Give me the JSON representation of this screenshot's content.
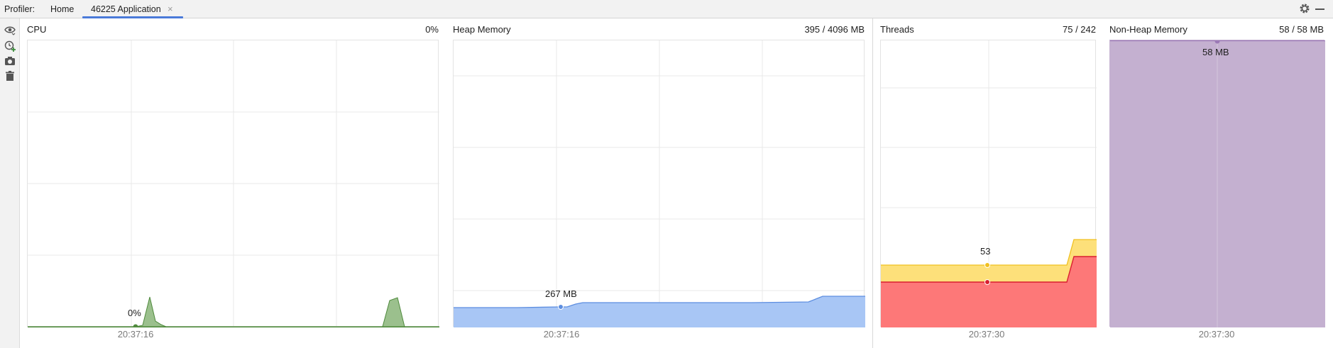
{
  "topbar": {
    "profiler_label": "Profiler:",
    "tab_home": "Home",
    "tab_app": "46225 Application",
    "tab_close": "×"
  },
  "panels": {
    "cpu": {
      "title": "CPU",
      "value": "0%",
      "hover_label": "0%",
      "time": "20:37:16"
    },
    "heap": {
      "title": "Heap Memory",
      "value": "395 / 4096 MB",
      "hover_label": "267 MB",
      "time": "20:37:16"
    },
    "threads": {
      "title": "Threads",
      "value": "75 / 242",
      "hover_label": "53",
      "time": "20:37:30"
    },
    "nonheap": {
      "title": "Non-Heap Memory",
      "value": "58 / 58 MB",
      "hover_label": "58 MB",
      "time": "20:37:30"
    }
  },
  "colors": {
    "cpu_fill": "#9bc08d",
    "cpu_line": "#4f8a3d",
    "heap_fill": "#a8c6f5",
    "heap_line": "#5d8ee0",
    "threads_total_fill": "#fde07a",
    "threads_total_line": "#f0c020",
    "threads_live_fill": "#fd7878",
    "threads_live_line": "#d91f2f",
    "nonheap_fill": "#c4b0d0",
    "nonheap_line": "#9c7ab6",
    "grid": "#e8e8e8"
  },
  "icons": {
    "sidebar": [
      "eye-icon",
      "add-profiler-icon",
      "camera-icon",
      "trash-icon"
    ],
    "topbar": [
      "gear-icon",
      "minimize-icon"
    ]
  }
}
